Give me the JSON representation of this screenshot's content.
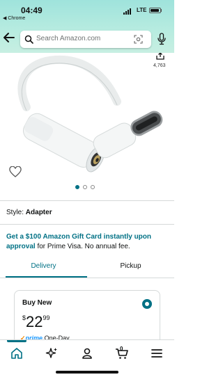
{
  "status_bar": {
    "time": "04:49",
    "back_app": "◀ Chrome",
    "network": "LTE"
  },
  "search": {
    "placeholder": "Search Amazon.com"
  },
  "product": {
    "rating_count": "4,763",
    "image_dots": 3,
    "active_dot": 1
  },
  "style": {
    "label": "Style:",
    "value": "Adapter"
  },
  "promo": {
    "link_text": "Get a $100 Amazon Gift Card instantly upon approval",
    "rest_text": " for Prime Visa. No annual fee."
  },
  "tabs": [
    {
      "label": "Delivery",
      "selected": true
    },
    {
      "label": "Pickup",
      "selected": false
    }
  ],
  "buy_option": {
    "label": "Buy New",
    "currency": "$",
    "price_whole": "22",
    "price_fraction": "99",
    "prime_check": "✓",
    "prime_word": "prime",
    "prime_speed": " One-Day"
  },
  "bottom_nav": {
    "cart_count": "0",
    "items": [
      "home-icon",
      "sparkle-icon",
      "account-icon",
      "cart-icon",
      "menu-icon"
    ]
  },
  "colors": {
    "accent": "#007185",
    "header_top": "#9fe3dc",
    "prime_blue": "#1a98ff",
    "prime_check": "#f08804"
  }
}
